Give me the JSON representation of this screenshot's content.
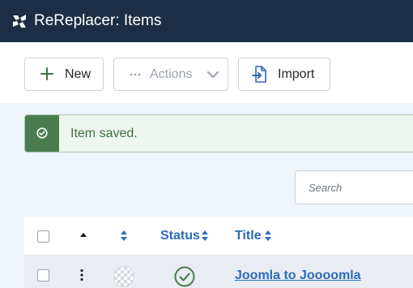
{
  "header": {
    "title": "ReReplacer: Items",
    "logo_icon": "joomla-logo-icon",
    "bg_color": "#1c2e45"
  },
  "toolbar": {
    "new_label": "New",
    "new_icon": "plus-icon",
    "actions_label": "Actions",
    "actions_icon": "ellipsis-icon",
    "actions_disabled": true,
    "import_label": "Import",
    "import_icon": "file-import-icon"
  },
  "alert": {
    "type": "success",
    "message": "Item saved.",
    "icon": "check-circle-icon",
    "color": "#4a7d4e"
  },
  "search": {
    "placeholder": "Search",
    "value": ""
  },
  "table": {
    "columns": [
      {
        "key": "select",
        "label": ""
      },
      {
        "key": "ordering",
        "label": "",
        "icon": "caret-up-icon"
      },
      {
        "key": "color",
        "label": "",
        "icon": "sort-icon"
      },
      {
        "key": "status",
        "label": "Status",
        "icon": "sort-icon"
      },
      {
        "key": "title",
        "label": "Title",
        "icon": "sort-icon"
      }
    ],
    "rows": [
      {
        "selected": false,
        "actions_icon": "vertical-ellipsis-icon",
        "color": "none",
        "status": "published",
        "status_icon": "check-circle-icon",
        "title": "Joomla to Joooomla"
      }
    ],
    "link_color": "#2a6bb8"
  }
}
